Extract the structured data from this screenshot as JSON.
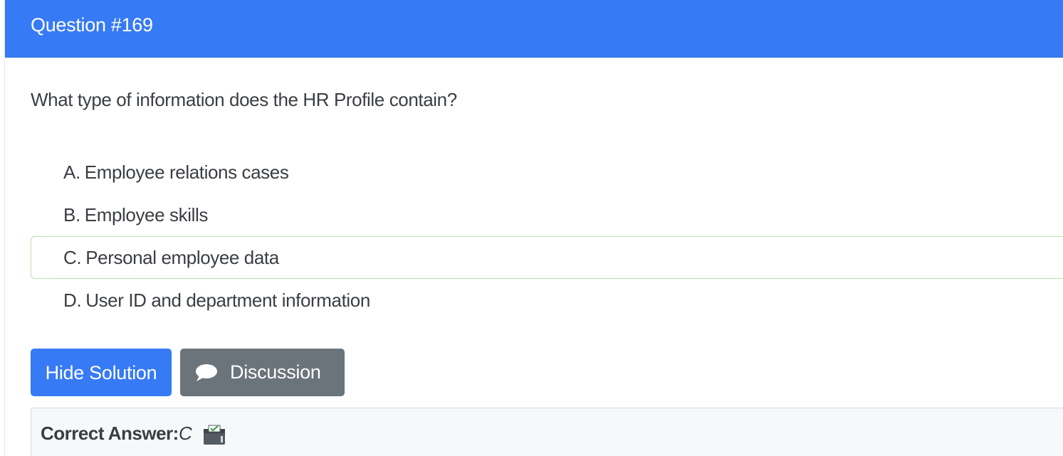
{
  "header": {
    "title": "Question #169"
  },
  "question": {
    "text": "What type of information does the HR Profile contain?",
    "choices": [
      {
        "letter": "A.",
        "text": "Employee relations cases"
      },
      {
        "letter": "B.",
        "text": "Employee skills"
      },
      {
        "letter": "C.",
        "text": "Personal employee data"
      },
      {
        "letter": "D.",
        "text": "User ID and department information"
      }
    ]
  },
  "actions": {
    "hide_solution_label": "Hide Solution",
    "discussion_label": "Discussion",
    "discussion_icon": "chat-bubble-icon"
  },
  "answer": {
    "label": "Correct Answer:",
    "value": "C",
    "icon": "vote-box-icon"
  },
  "colors": {
    "primary": "#377af5",
    "secondary": "#6b737b",
    "correct_border": "#b9e3b0",
    "answer_bg": "#f7f8fa"
  }
}
